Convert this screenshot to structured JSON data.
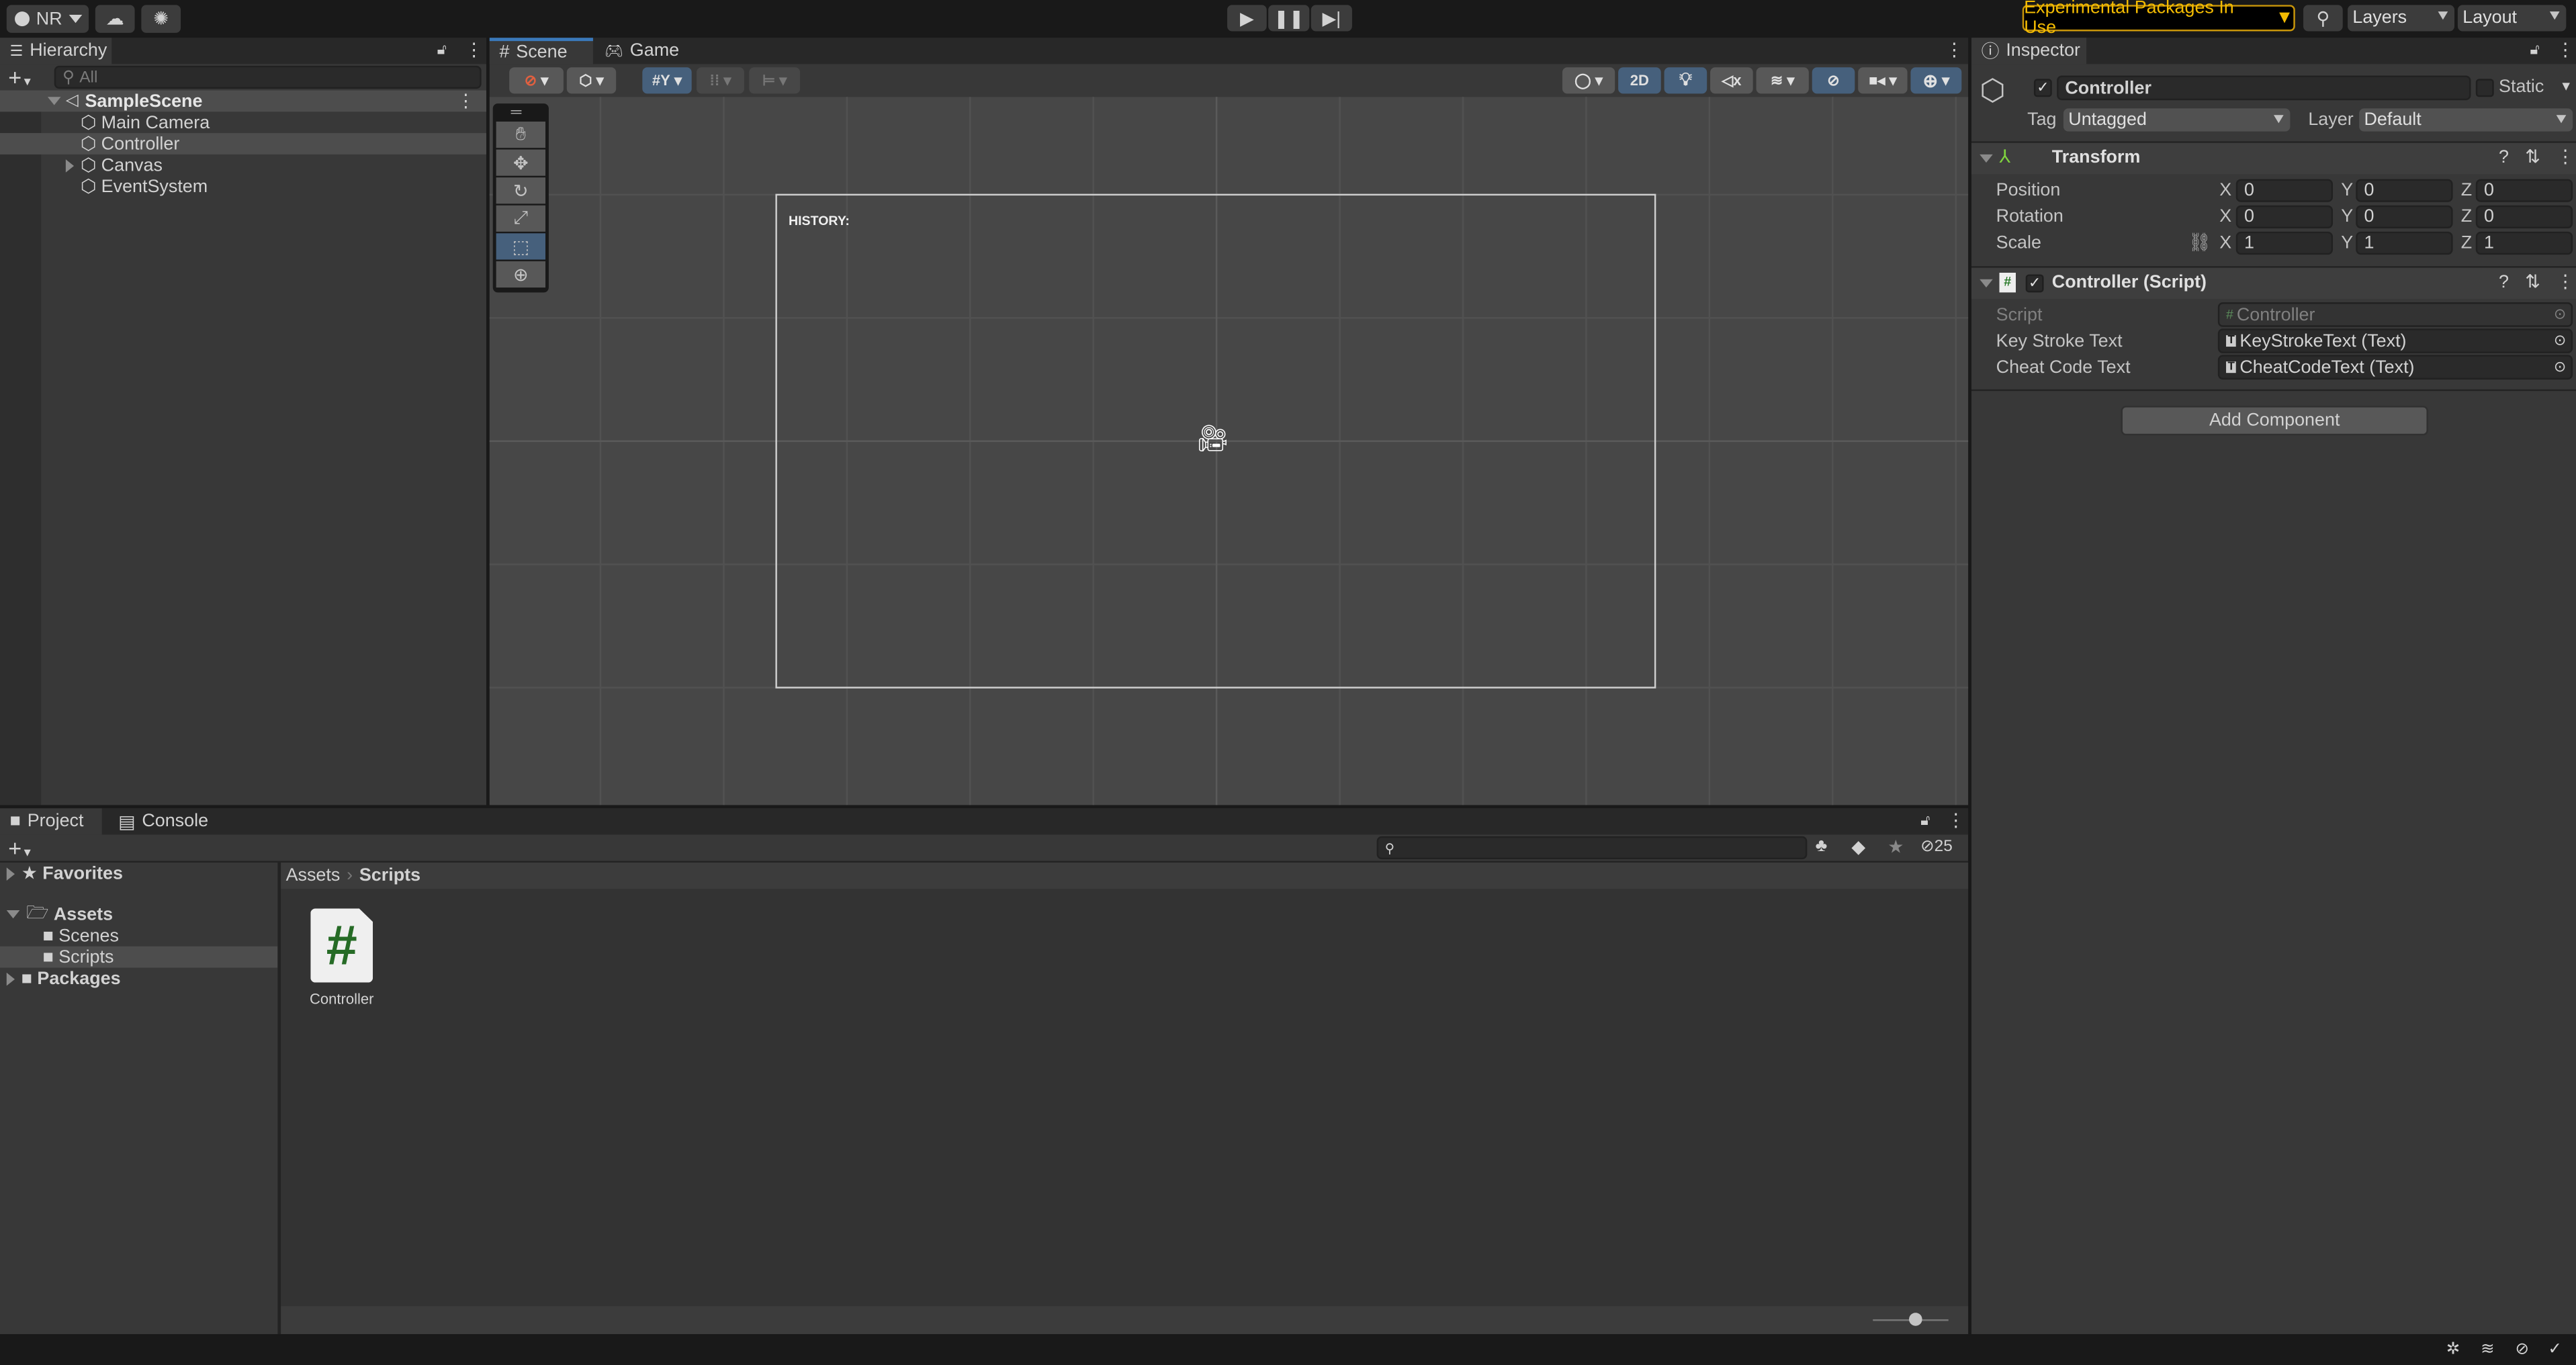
{
  "toolbar": {
    "account_label": "NR",
    "experimental_label": "Experimental Packages In Use",
    "layers_label": "Layers",
    "layout_label": "Layout",
    "accent_color": "#f4bc02"
  },
  "hierarchy": {
    "tab_label": "Hierarchy",
    "search_placeholder": "All",
    "scene_name": "SampleScene",
    "items": [
      {
        "label": "Main Camera",
        "expandable": false,
        "selected": false
      },
      {
        "label": "Controller",
        "expandable": false,
        "selected": true
      },
      {
        "label": "Canvas",
        "expandable": true,
        "selected": false
      },
      {
        "label": "EventSystem",
        "expandable": false,
        "selected": false
      }
    ]
  },
  "scene": {
    "tabs": [
      {
        "label": "Scene",
        "active": true
      },
      {
        "label": "Game",
        "active": false
      }
    ],
    "mode_2d_label": "2D",
    "canvas_text": "HISTORY:"
  },
  "inspector": {
    "tab_label": "Inspector",
    "object_name": "Controller",
    "active": true,
    "static_label": "Static",
    "tag_label": "Tag",
    "tag_value": "Untagged",
    "layer_label": "Layer",
    "layer_value": "Default",
    "transform": {
      "title": "Transform",
      "rows": [
        {
          "label": "Position",
          "x": "0",
          "y": "0",
          "z": "0"
        },
        {
          "label": "Rotation",
          "x": "0",
          "y": "0",
          "z": "0"
        },
        {
          "label": "Scale",
          "x": "1",
          "y": "1",
          "z": "1"
        }
      ],
      "axis_x": "X",
      "axis_y": "Y",
      "axis_z": "Z"
    },
    "script_component": {
      "title": "Controller (Script)",
      "fields": [
        {
          "label": "Script",
          "value": "Controller",
          "disabled": true
        },
        {
          "label": "Key Stroke Text",
          "value": "KeyStrokeText (Text)",
          "disabled": false
        },
        {
          "label": "Cheat Code Text",
          "value": "CheatCodeText (Text)",
          "disabled": false
        }
      ]
    },
    "add_component_label": "Add Component"
  },
  "project": {
    "tabs": [
      {
        "label": "Project",
        "active": true
      },
      {
        "label": "Console",
        "active": false
      }
    ],
    "tree": {
      "favorites": "Favorites",
      "assets": "Assets",
      "scenes": "Scenes",
      "scripts": "Scripts",
      "packages": "Packages"
    },
    "breadcrumb": [
      "Assets",
      "Scripts"
    ],
    "hidden_count": "25",
    "files": [
      {
        "name": "Controller",
        "type": "csharp-script"
      }
    ]
  }
}
